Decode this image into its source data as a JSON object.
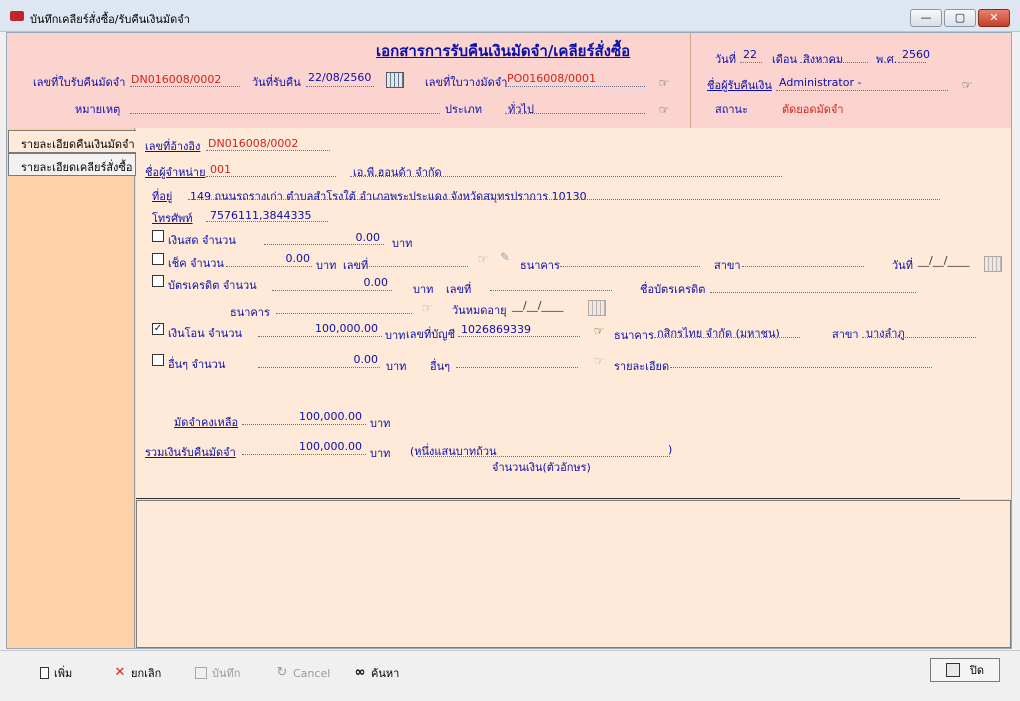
{
  "window": {
    "title": "บันทึกเคลียร์สั่งซื้อ/รับคืนเงินมัดจำ",
    "minimize": "—",
    "maximize": "▢",
    "close": "✕"
  },
  "header": {
    "doc_title": "เอกสารการรับคืนเงินมัดจำ/เคลียร์สั่งซื้อ",
    "receipt_no_label": "เลขที่ใบรับคืนมัดจำ",
    "receipt_no": "DN016008/0002",
    "receive_date_label": "วันที่รับคืน",
    "receive_date": "22/08/2560",
    "deposit_no_label": "เลขที่ใบวางมัดจำ",
    "deposit_no": "PO016008/0001",
    "remark_label": "หมายเหตุ",
    "type_label": "ประเภท",
    "type_value": "ทั่วไป",
    "day_label": "วันที่",
    "day": "22",
    "month_label": "เดือน",
    "month": "สิงหาคม",
    "year_label": "พ.ศ.",
    "year": "2560",
    "receiver_label": "ชื่อผู้รับคืนเงิน",
    "receiver": "Administrator -",
    "status_label": "สถานะ",
    "status": "ตัดยอดมัดจำ"
  },
  "tabs": [
    {
      "label": "รายละเอียดคืนเงินมัดจำ"
    },
    {
      "label": "รายละเอียดเคลียร์สั่งซื้อ"
    }
  ],
  "detail": {
    "ref_no_label": "เลขที่อ้างอิง",
    "ref_no": "DN016008/0002",
    "vendor_label": "ชื่อผู้จำหน่าย",
    "vendor_code": "001",
    "vendor_name": "เอ.พี.ฮอนด้า จำกัด",
    "address_label": "ที่อยู่",
    "address": "149 ถนนรถรางเก่า ตำบลสำโรงใต้ อำเภอพระประแดง จังหวัดสมุทรปราการ 10130",
    "phone_label": "โทรศัพท์",
    "phone": "7576111,3844335",
    "cash_label": "เงินสด จำนวน",
    "cash_amount": "0.00",
    "baht": "บาท",
    "cheque_label": "เช็ค จำนวน",
    "cheque_amount": "0.00",
    "number_label": "เลขที่",
    "bank_label": "ธนาคาร",
    "branch_label": "สาขา",
    "date_label": "วันที่",
    "date_blank": "__/__/____",
    "credit_label": "บัตรเครดิต  จำนวน",
    "credit_amount": "0.00",
    "card_name_label": "ชื่อบัตรเครดิต",
    "expire_label": "วันหมดอายุ",
    "transfer_label": "เงินโอน จำนวน",
    "transfer_amount": "100,000.00",
    "account_label": "เลขที่บัญชี",
    "account_no": "1026869339",
    "transfer_bank": "กสิกรไทย จำกัด (มหาชน)",
    "transfer_branch": "บางลำภู",
    "other_label": "อื่นๆ จำนวน",
    "other_amount": "0.00",
    "other_label2": "อื่นๆ",
    "detail_label": "รายละเอียด",
    "balance_label": "มัดจำคงเหลือ",
    "balance_amount": "100,000.00",
    "total_label": "รวมเงินรับคืนมัดจำ",
    "total_amount": "100,000.00",
    "text_amount": "(หนึ่งแสนบาทถ้วน",
    "text_close": ")",
    "text_caption": "จำนวนเงิน(ตัวอักษร)",
    "check_mark": "✓"
  },
  "toolbar": {
    "add": "เพิ่ม",
    "cancel_th": "ยกเลิก",
    "save": "บันทึก",
    "cancel_en": "Cancel",
    "search": "ค้นหา",
    "close": "ปิด"
  },
  "colors": {
    "label_blue": "#0b10a8",
    "value_red": "#d2241a",
    "header_bg": "#fbd3cf",
    "panel_bg": "#ffe9d8",
    "sidebar_bg": "#ffd1a8"
  }
}
